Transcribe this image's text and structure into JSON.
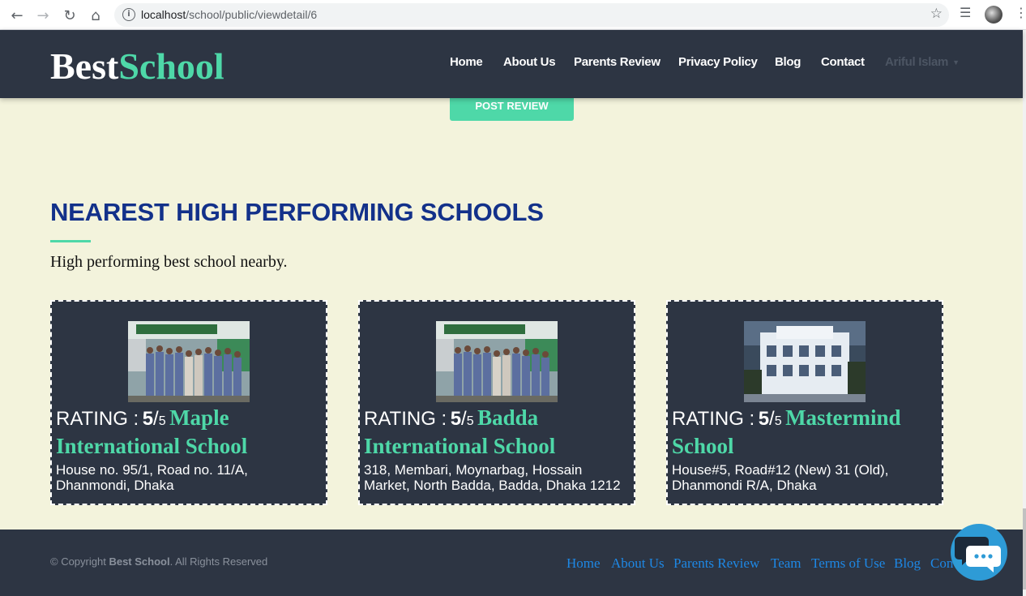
{
  "browser": {
    "url_host": "localhost",
    "url_path": "/school/public/viewdetail/6"
  },
  "header": {
    "brand_part1": "Best",
    "brand_part2": "School",
    "nav": [
      "Home",
      "About Us",
      "Parents Review",
      "Privacy Policy",
      "Blog",
      "Contact"
    ],
    "user_menu": "Ariful Islam"
  },
  "post_review_label": "POST REVIEW",
  "section": {
    "title": "NEAREST HIGH PERFORMING SCHOOLS",
    "subtitle": "High performing best school nearby."
  },
  "schools": [
    {
      "rating_label": "RATING :",
      "rating": "5",
      "rating_max": "5",
      "name": "Maple International School",
      "address": "House no. 95/1, Road no. 11/A, Dhanmondi, Dhaka"
    },
    {
      "rating_label": "RATING :",
      "rating": "5",
      "rating_max": "5",
      "name": "Badda International School",
      "address": "318, Membari, Moynarbag, Hossain Market, North Badda, Badda, Dhaka 1212"
    },
    {
      "rating_label": "RATING :",
      "rating": "5",
      "rating_max": "5",
      "name": "Mastermind School",
      "address": "House#5, Road#12 (New) 31 (Old), Dhanmondi R/A, Dhaka"
    }
  ],
  "footer": {
    "copyright_prefix": "© Copyright",
    "copyright_brand": "Best School",
    "copyright_suffix": ". All Rights Reserved",
    "links": [
      "Home",
      "About Us",
      "Parents Review",
      "Team",
      "Terms of Use",
      "Blog",
      "Con"
    ]
  },
  "colors": {
    "accent": "#4ed8a8",
    "dark": "#2d3543",
    "title_blue": "#13318a",
    "background": "#f3f3dc",
    "link_blue": "#1e88e5"
  }
}
